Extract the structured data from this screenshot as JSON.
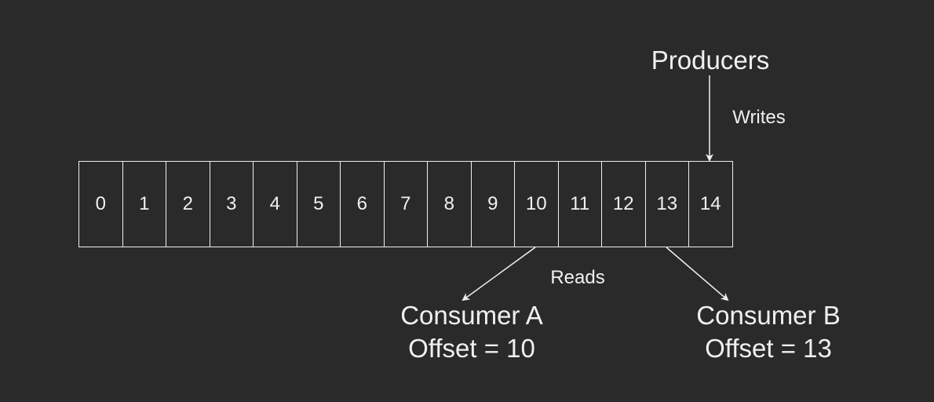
{
  "producers": {
    "label": "Producers",
    "action": "Writes"
  },
  "log": {
    "cells": [
      "0",
      "1",
      "2",
      "3",
      "4",
      "5",
      "6",
      "7",
      "8",
      "9",
      "10",
      "11",
      "12",
      "13",
      "14"
    ]
  },
  "reads_label": "Reads",
  "consumers": [
    {
      "name": "Consumer A",
      "offset": "Offset = 10"
    },
    {
      "name": "Consumer B",
      "offset": "Offset = 13"
    }
  ],
  "colors": {
    "background": "#2a2a2a",
    "foreground": "#f0f0f0"
  }
}
